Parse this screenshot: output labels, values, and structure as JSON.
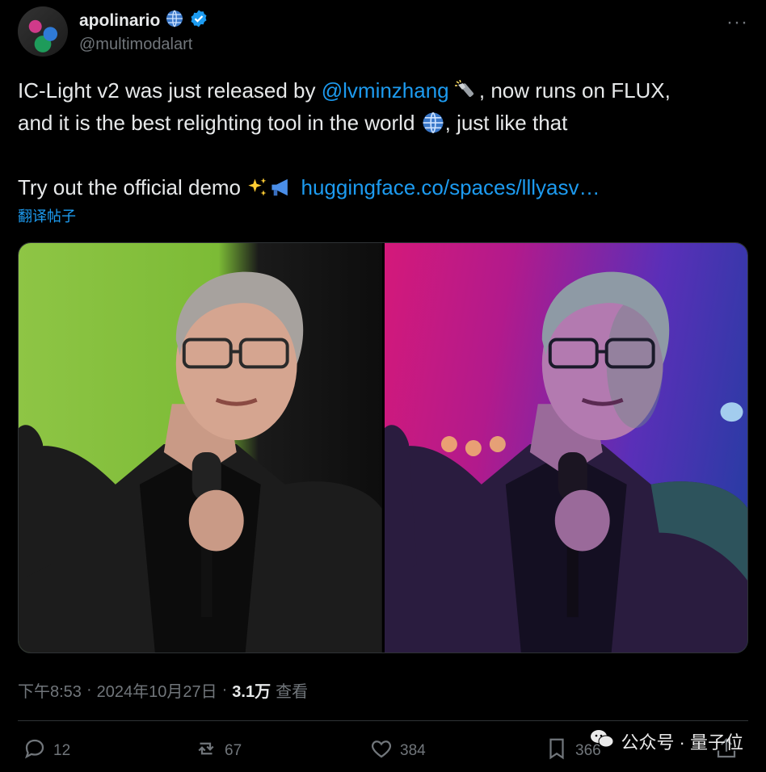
{
  "author": {
    "display_name": "apolinario",
    "handle": "@multimodalart"
  },
  "tweet": {
    "line1_a": "IC-Light v2 was just released by ",
    "line1_mention": "@lvminzhang",
    "line1_b": ", now runs on FLUX,",
    "line2_a": "and it is the best relighting tool in the world ",
    "line2_b": ",  just like that",
    "line3_a": "Try out the official demo ",
    "line3_link": "huggingface.co/spaces/lllyasv…",
    "translate_label": "翻译帖子"
  },
  "meta": {
    "time": "下午8:53",
    "sep1": "·",
    "date": "2024年10月27日",
    "sep2": "·",
    "views_count": "3.1万",
    "views_label": "查看"
  },
  "actions": {
    "replies": "12",
    "retweets": "67",
    "likes": "384",
    "bookmarks": "366"
  },
  "watermark": {
    "text": "公众号 · 量子位"
  },
  "icons": {
    "verified": "verified-badge-icon",
    "globe": "globe-icon",
    "flashlight": "flashlight-icon",
    "sparkles": "sparkles-icon",
    "megaphone": "megaphone-icon"
  },
  "colors": {
    "background": "#000000",
    "text": "#e7e9ea",
    "muted": "#71767b",
    "link": "#1d9bf0",
    "border": "#2f3336"
  }
}
